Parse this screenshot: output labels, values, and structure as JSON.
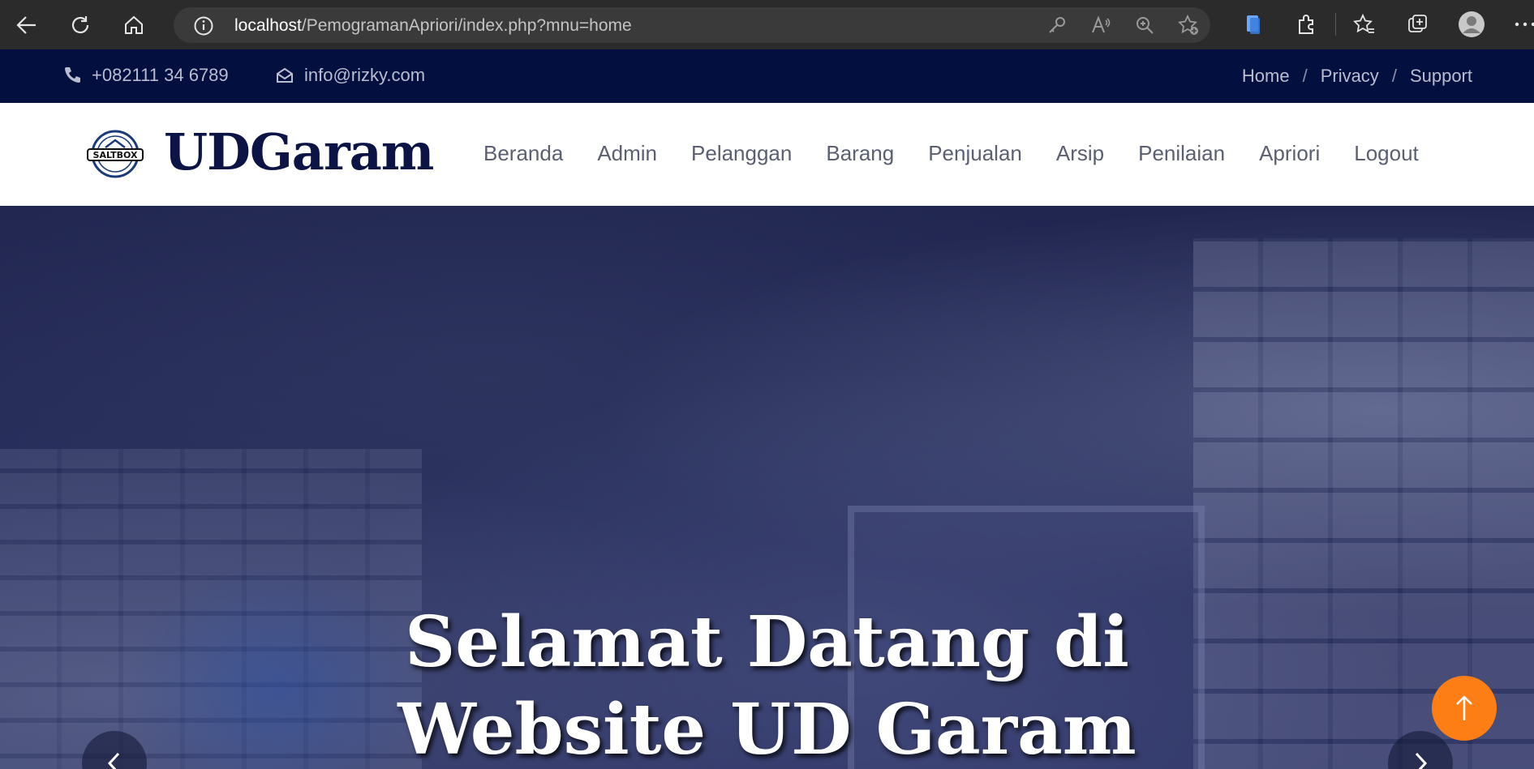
{
  "browser": {
    "url_host": "localhost",
    "url_path": "/PemogramanApriori/index.php?mnu=home"
  },
  "topbar": {
    "phone": "+082111 34 6789",
    "email": "info@rizky.com",
    "links": [
      "Home",
      "Privacy",
      "Support"
    ],
    "separator": "/"
  },
  "header": {
    "logo_text": "SALTBOX",
    "brand": "UDGaram",
    "menu": [
      "Beranda",
      "Admin",
      "Pelanggan",
      "Barang",
      "Penjualan",
      "Arsip",
      "Penilaian",
      "Apriori",
      "Logout"
    ]
  },
  "hero": {
    "title_line1": "Selamat Datang di",
    "title_line2": "Website UD Garam"
  },
  "colors": {
    "topbar_bg": "#030f3f",
    "brand": "#0b1445",
    "accent": "#fd7e14"
  }
}
